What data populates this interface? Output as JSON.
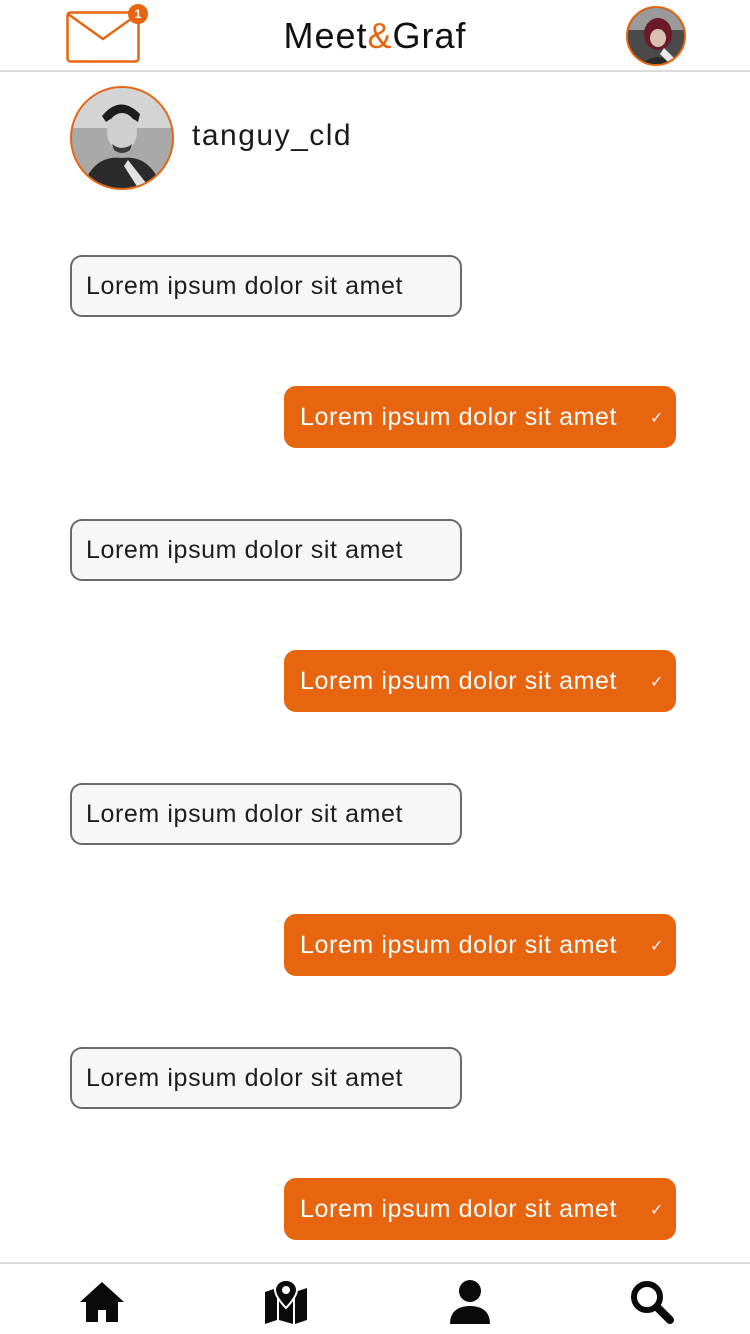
{
  "header": {
    "title_part1": "Meet",
    "title_amp": "&",
    "title_part2": "Graf",
    "mail_badge_count": "1",
    "mail_icon": "envelope-icon",
    "profile_avatar": "user-avatar"
  },
  "conversation": {
    "contact_name": "tanguy_cld",
    "messages": [
      {
        "direction": "in",
        "text": "Lorem ipsum dolor sit amet"
      },
      {
        "direction": "out",
        "text": "Lorem ipsum dolor sit amet",
        "status": "✓"
      },
      {
        "direction": "in",
        "text": "Lorem ipsum dolor sit amet"
      },
      {
        "direction": "out",
        "text": "Lorem ipsum dolor sit amet",
        "status": "✓"
      },
      {
        "direction": "in",
        "text": "Lorem ipsum dolor sit amet"
      },
      {
        "direction": "out",
        "text": "Lorem ipsum dolor sit amet",
        "status": "✓"
      },
      {
        "direction": "in",
        "text": "Lorem ipsum dolor sit amet"
      },
      {
        "direction": "out",
        "text": "Lorem ipsum dolor sit amet",
        "status": "✓"
      }
    ]
  },
  "bottom_nav": {
    "items": [
      {
        "icon": "home-icon"
      },
      {
        "icon": "map-icon"
      },
      {
        "icon": "profile-icon"
      },
      {
        "icon": "search-icon"
      }
    ]
  },
  "colors": {
    "accent": "#e8650f",
    "incoming_bubble_bg": "#f7f7f7",
    "incoming_bubble_border": "#6b6b6b",
    "text": "#1a1a1a"
  }
}
